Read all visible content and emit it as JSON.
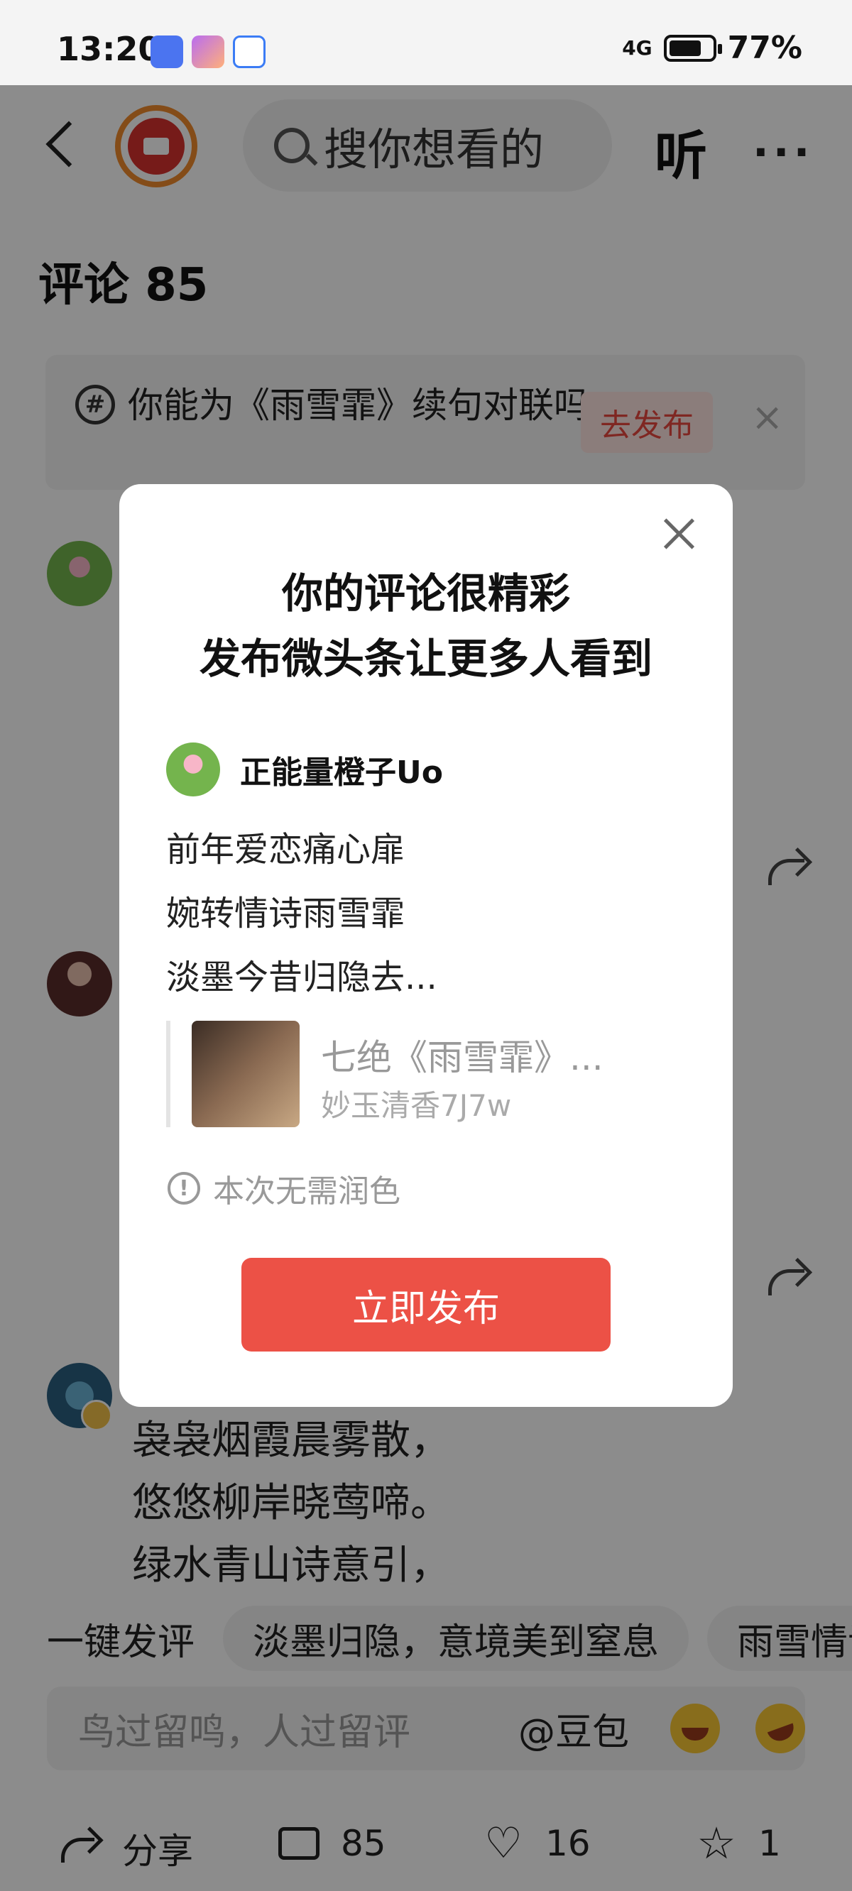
{
  "status_bar": {
    "time": "13:20",
    "network": "4G",
    "battery": "77%"
  },
  "top_nav": {
    "search_placeholder": "搜你想看的",
    "listen_label": "听",
    "more_label": "···"
  },
  "comments": {
    "title": "评论 85",
    "topic": {
      "text": "你能为《雨雪霏》续句对联吗",
      "publish_label": "去发布",
      "close_label": "×"
    },
    "visible_poem_lines": [
      "袅袅烟霞晨雾散，",
      "悠悠柳岸晓莺啼。",
      "绿水青山诗意引，"
    ]
  },
  "quick_comment": {
    "label": "一键发评",
    "chips": [
      "淡墨归隐，意境美到窒息",
      "雨雪情诗"
    ]
  },
  "input_bar": {
    "placeholder": "鸟过留鸣，人过留评",
    "doubao_label": "@豆包"
  },
  "actions": {
    "share_label": "分享",
    "comment_count": "85",
    "like_count": "16",
    "favorite_count": "1"
  },
  "modal": {
    "title_line1": "你的评论很精彩",
    "title_line2": "发布微头条让更多人看到",
    "author_name": "正能量橙子Uo",
    "post_lines": [
      "前年爱恋痛心扉",
      "婉转情诗雨雪霏",
      "淡墨今昔归隐去..."
    ],
    "quote_title": "七绝《雨雪霏》...",
    "quote_author": "妙玉清香7J7w",
    "notice_text": "本次无需润色",
    "publish_button": "立即发布"
  }
}
